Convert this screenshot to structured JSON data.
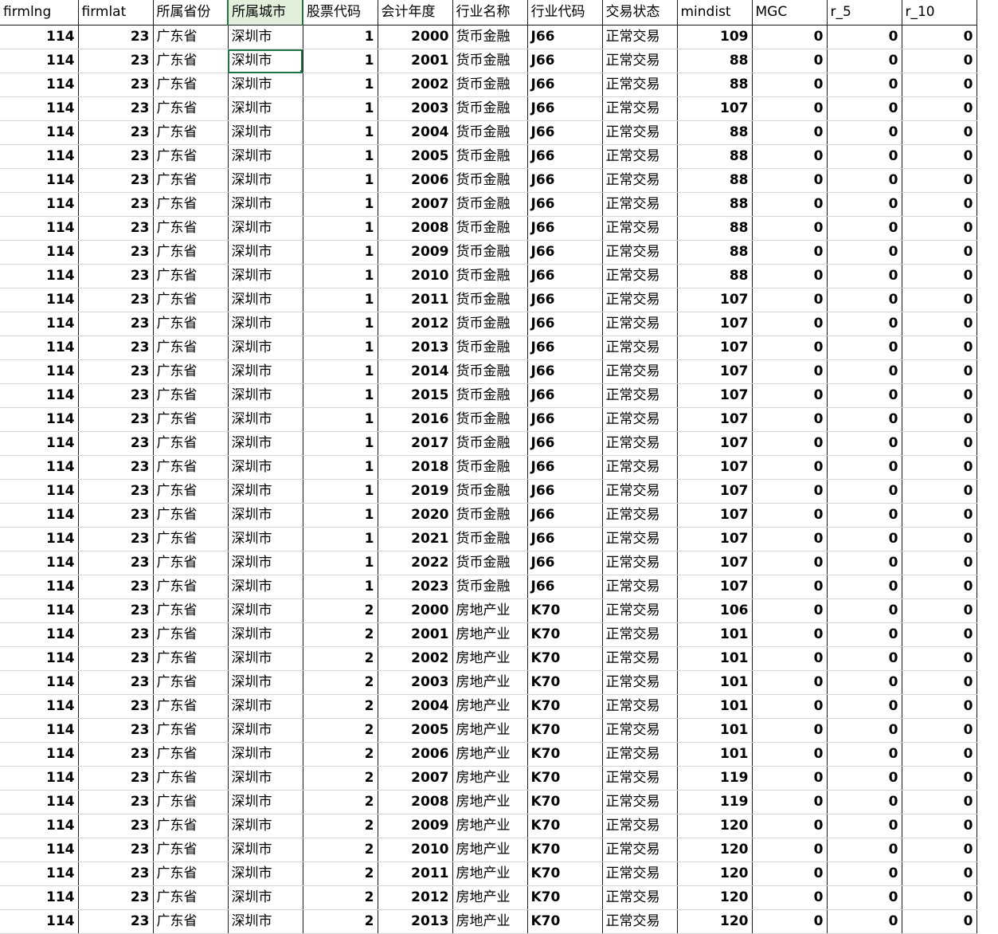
{
  "headers": [
    "firmlng",
    "firmlat",
    "所属省份",
    "所属城市",
    "股票代码",
    "会计年度",
    "行业名称",
    "行业代码",
    "交易状态",
    "mindist",
    "MGC",
    "r_5",
    "r_10"
  ],
  "rows": [
    [
      "114",
      "23",
      "广东省",
      "深圳市",
      "1",
      "2000",
      "货币金融",
      "J66",
      "正常交易",
      "109",
      "0",
      "0",
      "0"
    ],
    [
      "114",
      "23",
      "广东省",
      "深圳市",
      "1",
      "2001",
      "货币金融",
      "J66",
      "正常交易",
      "88",
      "0",
      "0",
      "0"
    ],
    [
      "114",
      "23",
      "广东省",
      "深圳市",
      "1",
      "2002",
      "货币金融",
      "J66",
      "正常交易",
      "88",
      "0",
      "0",
      "0"
    ],
    [
      "114",
      "23",
      "广东省",
      "深圳市",
      "1",
      "2003",
      "货币金融",
      "J66",
      "正常交易",
      "107",
      "0",
      "0",
      "0"
    ],
    [
      "114",
      "23",
      "广东省",
      "深圳市",
      "1",
      "2004",
      "货币金融",
      "J66",
      "正常交易",
      "88",
      "0",
      "0",
      "0"
    ],
    [
      "114",
      "23",
      "广东省",
      "深圳市",
      "1",
      "2005",
      "货币金融",
      "J66",
      "正常交易",
      "88",
      "0",
      "0",
      "0"
    ],
    [
      "114",
      "23",
      "广东省",
      "深圳市",
      "1",
      "2006",
      "货币金融",
      "J66",
      "正常交易",
      "88",
      "0",
      "0",
      "0"
    ],
    [
      "114",
      "23",
      "广东省",
      "深圳市",
      "1",
      "2007",
      "货币金融",
      "J66",
      "正常交易",
      "88",
      "0",
      "0",
      "0"
    ],
    [
      "114",
      "23",
      "广东省",
      "深圳市",
      "1",
      "2008",
      "货币金融",
      "J66",
      "正常交易",
      "88",
      "0",
      "0",
      "0"
    ],
    [
      "114",
      "23",
      "广东省",
      "深圳市",
      "1",
      "2009",
      "货币金融",
      "J66",
      "正常交易",
      "88",
      "0",
      "0",
      "0"
    ],
    [
      "114",
      "23",
      "广东省",
      "深圳市",
      "1",
      "2010",
      "货币金融",
      "J66",
      "正常交易",
      "88",
      "0",
      "0",
      "0"
    ],
    [
      "114",
      "23",
      "广东省",
      "深圳市",
      "1",
      "2011",
      "货币金融",
      "J66",
      "正常交易",
      "107",
      "0",
      "0",
      "0"
    ],
    [
      "114",
      "23",
      "广东省",
      "深圳市",
      "1",
      "2012",
      "货币金融",
      "J66",
      "正常交易",
      "107",
      "0",
      "0",
      "0"
    ],
    [
      "114",
      "23",
      "广东省",
      "深圳市",
      "1",
      "2013",
      "货币金融",
      "J66",
      "正常交易",
      "107",
      "0",
      "0",
      "0"
    ],
    [
      "114",
      "23",
      "广东省",
      "深圳市",
      "1",
      "2014",
      "货币金融",
      "J66",
      "正常交易",
      "107",
      "0",
      "0",
      "0"
    ],
    [
      "114",
      "23",
      "广东省",
      "深圳市",
      "1",
      "2015",
      "货币金融",
      "J66",
      "正常交易",
      "107",
      "0",
      "0",
      "0"
    ],
    [
      "114",
      "23",
      "广东省",
      "深圳市",
      "1",
      "2016",
      "货币金融",
      "J66",
      "正常交易",
      "107",
      "0",
      "0",
      "0"
    ],
    [
      "114",
      "23",
      "广东省",
      "深圳市",
      "1",
      "2017",
      "货币金融",
      "J66",
      "正常交易",
      "107",
      "0",
      "0",
      "0"
    ],
    [
      "114",
      "23",
      "广东省",
      "深圳市",
      "1",
      "2018",
      "货币金融",
      "J66",
      "正常交易",
      "107",
      "0",
      "0",
      "0"
    ],
    [
      "114",
      "23",
      "广东省",
      "深圳市",
      "1",
      "2019",
      "货币金融",
      "J66",
      "正常交易",
      "107",
      "0",
      "0",
      "0"
    ],
    [
      "114",
      "23",
      "广东省",
      "深圳市",
      "1",
      "2020",
      "货币金融",
      "J66",
      "正常交易",
      "107",
      "0",
      "0",
      "0"
    ],
    [
      "114",
      "23",
      "广东省",
      "深圳市",
      "1",
      "2021",
      "货币金融",
      "J66",
      "正常交易",
      "107",
      "0",
      "0",
      "0"
    ],
    [
      "114",
      "23",
      "广东省",
      "深圳市",
      "1",
      "2022",
      "货币金融",
      "J66",
      "正常交易",
      "107",
      "0",
      "0",
      "0"
    ],
    [
      "114",
      "23",
      "广东省",
      "深圳市",
      "1",
      "2023",
      "货币金融",
      "J66",
      "正常交易",
      "107",
      "0",
      "0",
      "0"
    ],
    [
      "114",
      "23",
      "广东省",
      "深圳市",
      "2",
      "2000",
      "房地产业",
      "K70",
      "正常交易",
      "106",
      "0",
      "0",
      "0"
    ],
    [
      "114",
      "23",
      "广东省",
      "深圳市",
      "2",
      "2001",
      "房地产业",
      "K70",
      "正常交易",
      "101",
      "0",
      "0",
      "0"
    ],
    [
      "114",
      "23",
      "广东省",
      "深圳市",
      "2",
      "2002",
      "房地产业",
      "K70",
      "正常交易",
      "101",
      "0",
      "0",
      "0"
    ],
    [
      "114",
      "23",
      "广东省",
      "深圳市",
      "2",
      "2003",
      "房地产业",
      "K70",
      "正常交易",
      "101",
      "0",
      "0",
      "0"
    ],
    [
      "114",
      "23",
      "广东省",
      "深圳市",
      "2",
      "2004",
      "房地产业",
      "K70",
      "正常交易",
      "101",
      "0",
      "0",
      "0"
    ],
    [
      "114",
      "23",
      "广东省",
      "深圳市",
      "2",
      "2005",
      "房地产业",
      "K70",
      "正常交易",
      "101",
      "0",
      "0",
      "0"
    ],
    [
      "114",
      "23",
      "广东省",
      "深圳市",
      "2",
      "2006",
      "房地产业",
      "K70",
      "正常交易",
      "101",
      "0",
      "0",
      "0"
    ],
    [
      "114",
      "23",
      "广东省",
      "深圳市",
      "2",
      "2007",
      "房地产业",
      "K70",
      "正常交易",
      "119",
      "0",
      "0",
      "0"
    ],
    [
      "114",
      "23",
      "广东省",
      "深圳市",
      "2",
      "2008",
      "房地产业",
      "K70",
      "正常交易",
      "119",
      "0",
      "0",
      "0"
    ],
    [
      "114",
      "23",
      "广东省",
      "深圳市",
      "2",
      "2009",
      "房地产业",
      "K70",
      "正常交易",
      "120",
      "0",
      "0",
      "0"
    ],
    [
      "114",
      "23",
      "广东省",
      "深圳市",
      "2",
      "2010",
      "房地产业",
      "K70",
      "正常交易",
      "120",
      "0",
      "0",
      "0"
    ],
    [
      "114",
      "23",
      "广东省",
      "深圳市",
      "2",
      "2011",
      "房地产业",
      "K70",
      "正常交易",
      "120",
      "0",
      "0",
      "0"
    ],
    [
      "114",
      "23",
      "广东省",
      "深圳市",
      "2",
      "2012",
      "房地产业",
      "K70",
      "正常交易",
      "120",
      "0",
      "0",
      "0"
    ],
    [
      "114",
      "23",
      "广东省",
      "深圳市",
      "2",
      "2013",
      "房地产业",
      "K70",
      "正常交易",
      "120",
      "0",
      "0",
      "0"
    ]
  ],
  "column_align": [
    "num",
    "num",
    "txt",
    "txt",
    "num",
    "num",
    "txt",
    "txt",
    "txt",
    "num",
    "num",
    "num",
    "num"
  ],
  "active_column_index": 3,
  "active_cell": {
    "row": 1,
    "col": 3
  },
  "accent_color": "#217346"
}
